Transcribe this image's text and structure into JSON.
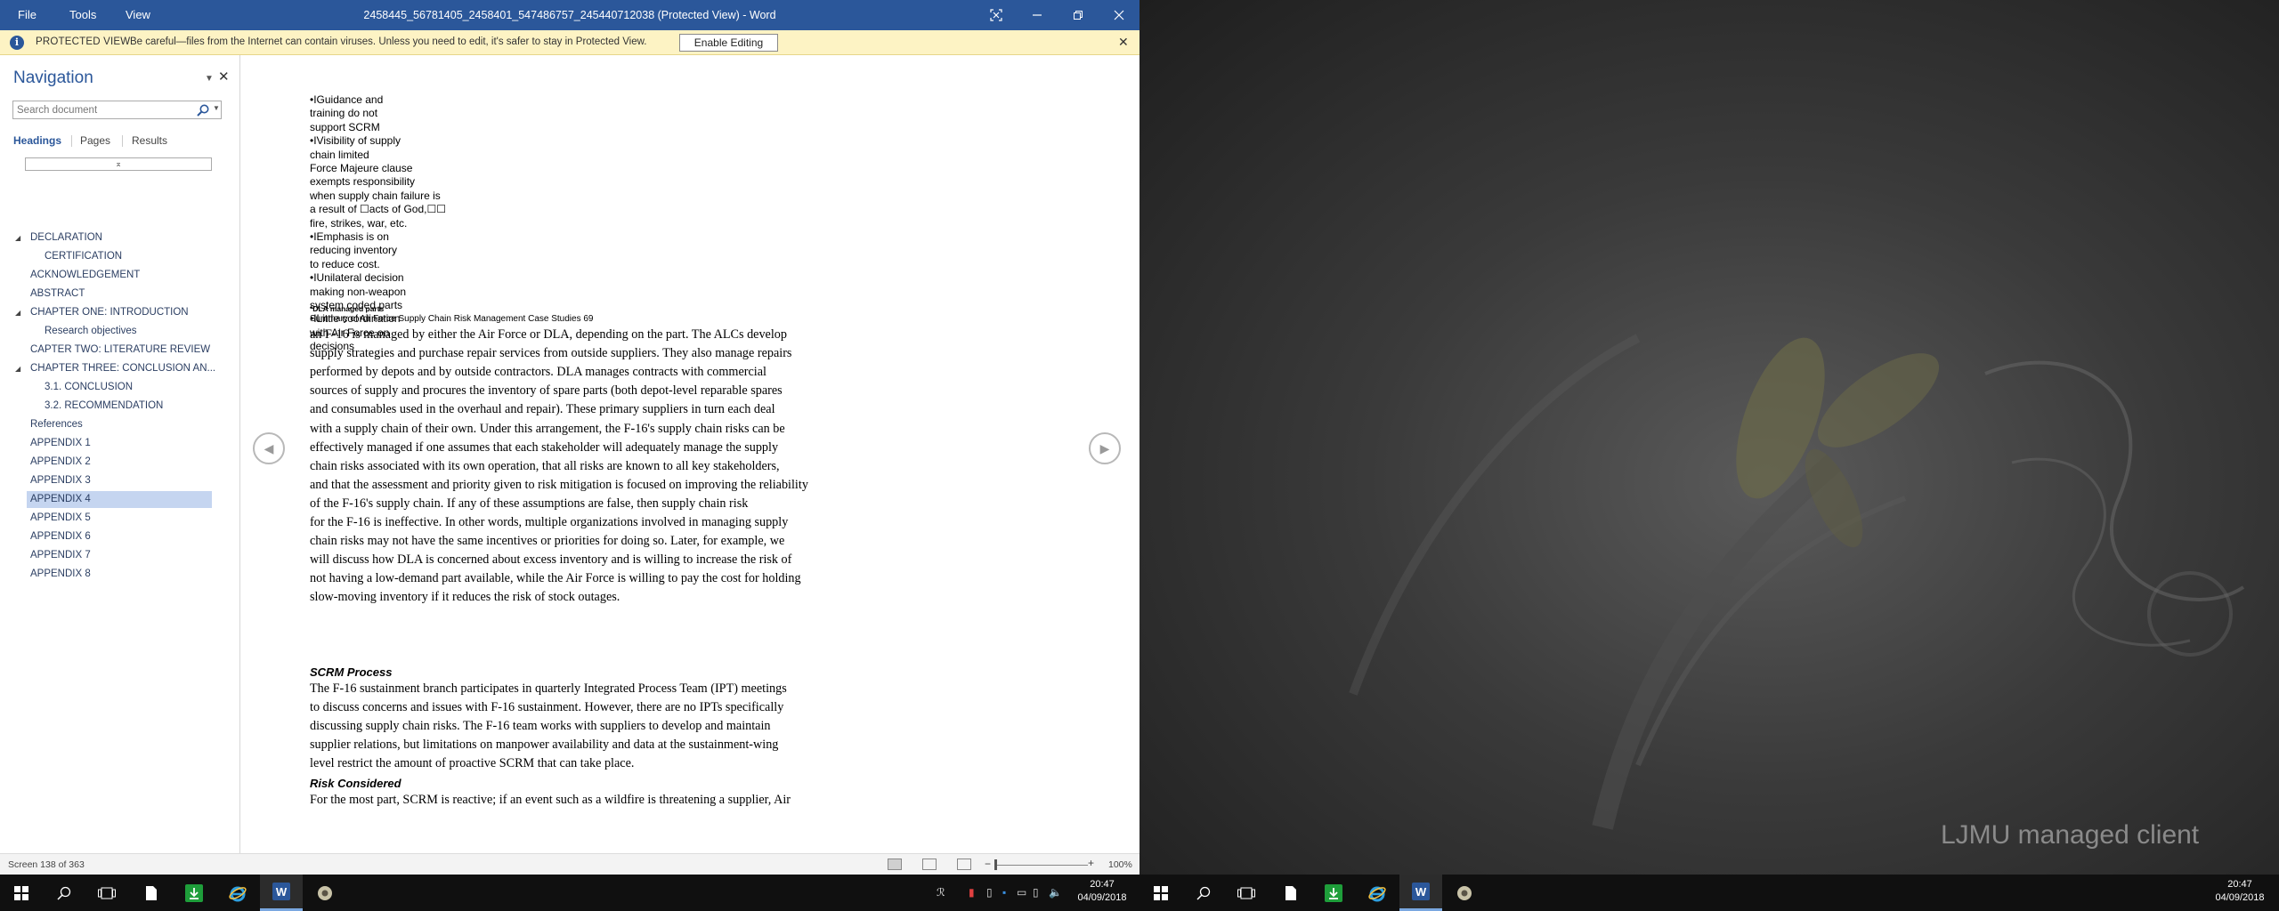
{
  "window": {
    "menu": [
      "File",
      "Tools",
      "View"
    ],
    "title": "2458445_56781405_2458401_547486757_245440712038 (Protected View) - Word"
  },
  "protected_view": {
    "label": "PROTECTED VIEW",
    "message": "Be careful—files from the Internet can contain viruses. Unless you need to edit, it's safer to stay in Protected View.",
    "enable_button": "Enable Editing"
  },
  "navigation": {
    "title": "Navigation",
    "search_placeholder": "Search document",
    "tabs": [
      "Headings",
      "Pages",
      "Results"
    ],
    "headings": [
      {
        "label": "DECLARATION",
        "level": 1,
        "expander": true
      },
      {
        "label": "CERTIFICATION",
        "level": 2
      },
      {
        "label": "ACKNOWLEDGEMENT",
        "level": 1
      },
      {
        "label": "ABSTRACT",
        "level": 1
      },
      {
        "label": "CHAPTER ONE: INTRODUCTION",
        "level": 1,
        "expander": true
      },
      {
        "label": "Research objectives",
        "level": 2
      },
      {
        "label": "CAPTER TWO: LITERATURE REVIEW",
        "level": 1
      },
      {
        "label": "CHAPTER THREE: CONCLUSION AN...",
        "level": 1,
        "expander": true
      },
      {
        "label": "3.1. CONCLUSION",
        "level": 2
      },
      {
        "label": "3.2. RECOMMENDATION",
        "level": 2
      },
      {
        "label": "References",
        "level": 1
      },
      {
        "label": "APPENDIX 1",
        "level": 1
      },
      {
        "label": "APPENDIX 2",
        "level": 1
      },
      {
        "label": "APPENDIX 3",
        "level": 1
      },
      {
        "label": "APPENDIX 4",
        "level": 1,
        "selected": true
      },
      {
        "label": "APPENDIX 5",
        "level": 1
      },
      {
        "label": "APPENDIX 6",
        "level": 1
      },
      {
        "label": "APPENDIX 7",
        "level": 1
      },
      {
        "label": "APPENDIX 8",
        "level": 1
      }
    ]
  },
  "document": {
    "bullet_lines": [
      "•IGuidance and",
      "training do not",
      "support SCRM",
      "•IVisibility of supply",
      "chain limited",
      "Force Majeure clause",
      "exempts responsibility",
      "when supply chain failure is",
      "a result of ☐acts of God,☐☐",
      "fire, strikes, war, etc.",
      "•IEmphasis is on",
      "reducing inventory",
      "to reduce cost.",
      "•IUnilateral decision",
      "making non-weapon",
      "system coded parts",
      "•ILittle coordination",
      "with Air Force on",
      "decisions"
    ],
    "footnote": "*DLA managed parts",
    "caption": "Summary of Air Force Supply Chain Risk Management Case Studies 69",
    "para1": [
      "an F-16 is managed by either the Air Force or DLA, depending on the part. The ALCs develop",
      "supply strategies and purchase repair services from outside suppliers. They also manage repairs",
      "performed by depots and by outside contractors. DLA manages contracts with commercial",
      "sources of supply and procures the inventory of spare parts (both depot-level reparable spares",
      "and consumables used in the overhaul and repair). These primary suppliers in turn each deal",
      "with a supply chain of their own. Under this arrangement, the F-16's supply chain risks can be",
      "effectively managed if one assumes that each stakeholder will adequately manage the supply",
      "chain risks associated with its own operation, that all risks are known to all key stakeholders,",
      "and that the assessment and priority given to risk mitigation is focused on improving the reliability",
      "of the F-16's supply chain. If any of these assumptions are false, then supply chain risk",
      "for the F-16 is ineffective. In other words, multiple organizations involved in managing supply",
      "chain risks may not have the same incentives or priorities for doing so. Later, for example, we",
      "will discuss how DLA is concerned about excess inventory and is willing to increase the risk of",
      "not having a low-demand part available, while the Air Force is willing to pay the cost for holding",
      "slow-moving inventory if it reduces the risk of stock outages."
    ],
    "heading2": "SCRM Process",
    "para2": [
      "The F-16 sustainment branch participates in quarterly Integrated Process Team (IPT) meetings",
      "to discuss concerns and issues with F-16 sustainment. However, there are no IPTs specifically",
      "discussing supply chain risks. The F-16 team works with suppliers to develop and maintain",
      "supplier relations, but limitations on manpower availability and data at the sustainment-wing",
      "level restrict the amount of proactive SCRM that can take place."
    ],
    "heading3": "Risk Considered",
    "para3": [
      "For the most part, SCRM is reactive; if an event such as a wildfire is threatening a supplier, Air"
    ]
  },
  "status": {
    "screen": "Screen 138 of 363",
    "zoom": "100%",
    "zoom_level": 0.0
  },
  "desktop": {
    "brand": "LJMU managed client"
  },
  "taskbar_left": {
    "time": "20:47",
    "date": "04/09/2018"
  },
  "taskbar_right": {
    "time": "20:47",
    "date": "04/09/2018"
  },
  "colors": {
    "word_blue": "#2b579a",
    "protected_bar": "#fdf3c4",
    "selected_heading": "#c5d5f0",
    "taskbar": "#101010"
  }
}
